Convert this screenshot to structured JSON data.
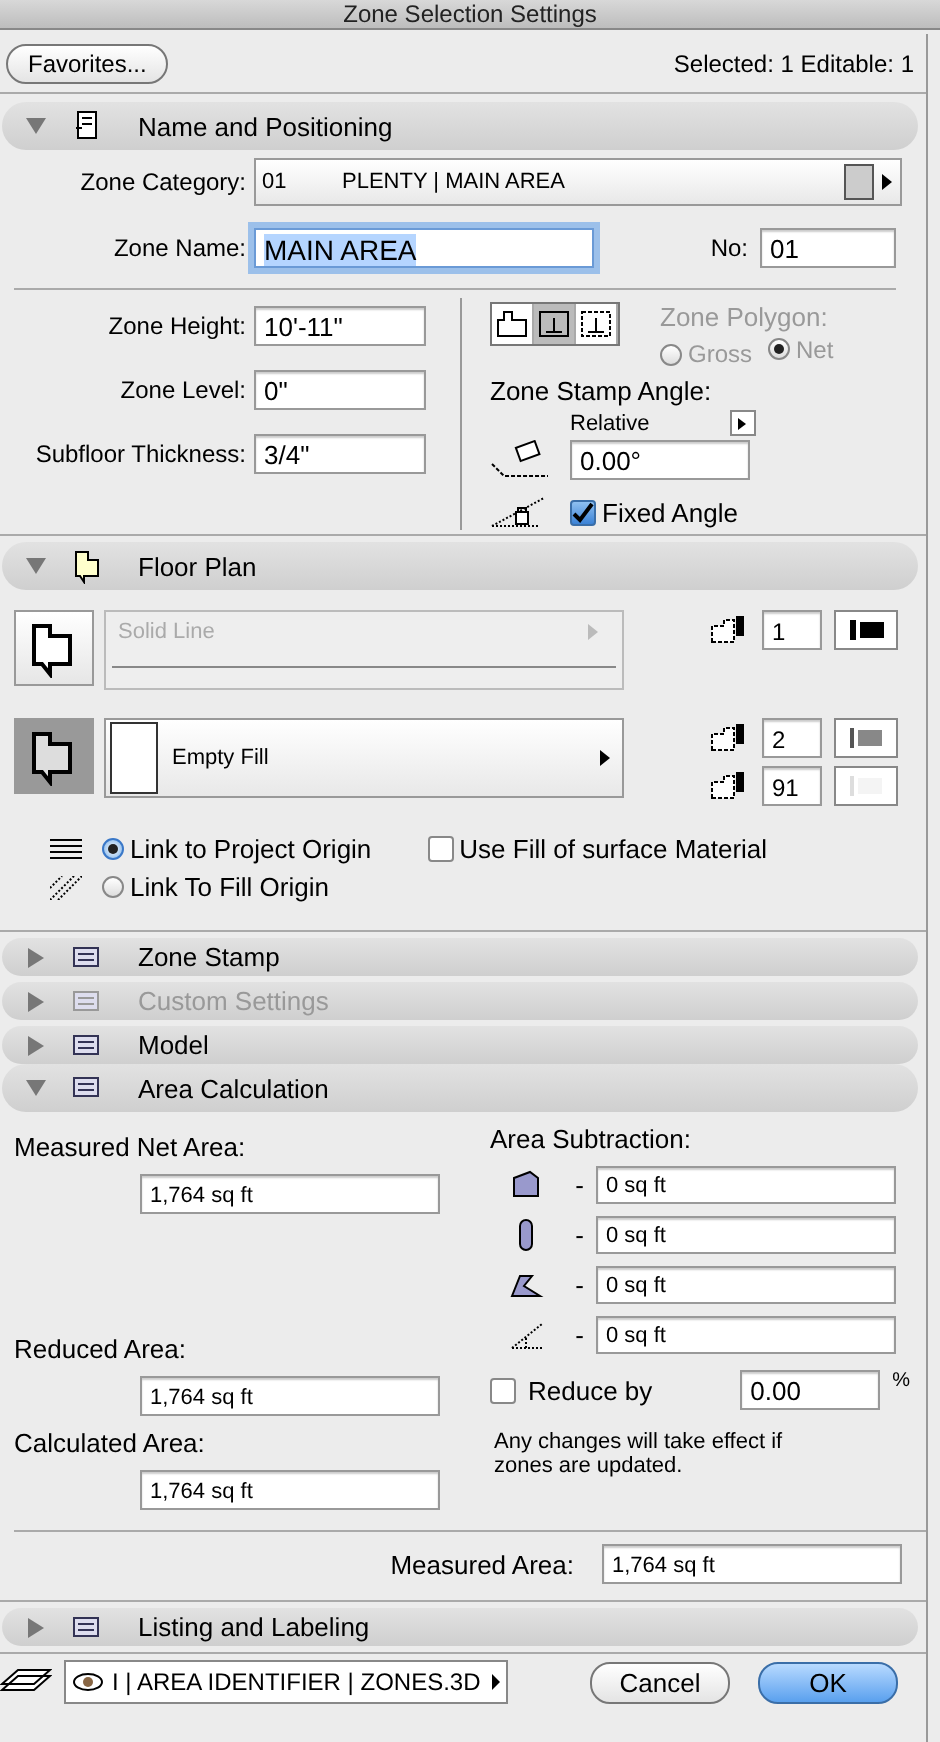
{
  "window": {
    "title": "Zone Selection Settings"
  },
  "favorites_button": "Favorites...",
  "selection_info": "Selected: 1 Editable: 1",
  "sections": [
    {
      "kind": "name_positioning",
      "title": "Name and Positioning",
      "expanded": true,
      "disabled": false,
      "zone_category": {
        "label": "Zone Category:",
        "code": "01",
        "value": "PLENTY | MAIN AREA"
      },
      "zone_name": {
        "label": "Zone Name:",
        "value": "MAIN AREA",
        "focused": true
      },
      "number": {
        "label": "No:",
        "value": "01"
      },
      "fields": [
        {
          "label": "Zone Height:",
          "value": "10'-11\""
        },
        {
          "label": "Zone Level:",
          "value": "0\""
        },
        {
          "label": "Subfloor Thickness:",
          "value": "3/4\""
        }
      ],
      "polygon_tools": [
        {
          "selected": false
        },
        {
          "selected": true
        },
        {
          "selected": false
        }
      ],
      "zone_polygon": {
        "label": "Zone Polygon:",
        "disabled": true,
        "options": [
          {
            "label": "Gross",
            "selected": false
          },
          {
            "label": "Net",
            "selected": true
          }
        ]
      },
      "stamp_angle": {
        "label": "Zone Stamp Angle:",
        "mode": "Relative",
        "value": "0.00°",
        "fixed_angle": {
          "label": "Fixed Angle",
          "checked": true
        }
      }
    },
    {
      "kind": "floor_plan",
      "title": "Floor Plan",
      "expanded": true,
      "disabled": false,
      "line": {
        "value": "Solid Line",
        "disabled": true,
        "pen": "1"
      },
      "fill": {
        "value": "Empty Fill",
        "pens": [
          "2",
          "91"
        ]
      },
      "origin": [
        {
          "label": "Link to Project Origin",
          "selected": true
        },
        {
          "label": "Link To Fill Origin",
          "selected": false
        }
      ],
      "surface_fill": {
        "label": "Use Fill of surface Material",
        "checked": false
      }
    },
    {
      "kind": "collapsed",
      "title": "Zone Stamp",
      "expanded": false,
      "disabled": false
    },
    {
      "kind": "collapsed",
      "title": "Custom Settings",
      "expanded": false,
      "disabled": true
    },
    {
      "kind": "collapsed",
      "title": "Model",
      "expanded": false,
      "disabled": false
    },
    {
      "kind": "area_calculation",
      "title": "Area Calculation",
      "expanded": true,
      "disabled": false,
      "measured_net": {
        "label": "Measured Net Area:",
        "value": "1,764 sq ft"
      },
      "reduced": {
        "label": "Reduced Area:",
        "value": "1,764 sq ft"
      },
      "calculated": {
        "label": "Calculated Area:",
        "value": "1,764 sq ft"
      },
      "subtraction": {
        "label": "Area Subtraction:",
        "rows": [
          {
            "prefix": "-",
            "value": "0 sq ft"
          },
          {
            "prefix": "-",
            "value": "0 sq ft"
          },
          {
            "prefix": "-",
            "value": "0 sq ft"
          },
          {
            "prefix": "-",
            "value": "0 sq ft"
          }
        ]
      },
      "reduce_by": {
        "label": "Reduce by",
        "checked": false,
        "value": "0.00",
        "unit": "%"
      },
      "note": "Any changes will take effect if zones are updated.",
      "measured_area": {
        "label": "Measured Area:",
        "value": "1,764 sq ft"
      }
    },
    {
      "kind": "collapsed",
      "title": "Listing and Labeling",
      "expanded": false,
      "disabled": false
    }
  ],
  "footer": {
    "layer": "I | AREA IDENTIFIER | ZONES.3D",
    "buttons": [
      {
        "label": "Cancel",
        "default": false
      },
      {
        "label": "OK",
        "default": true
      }
    ]
  }
}
